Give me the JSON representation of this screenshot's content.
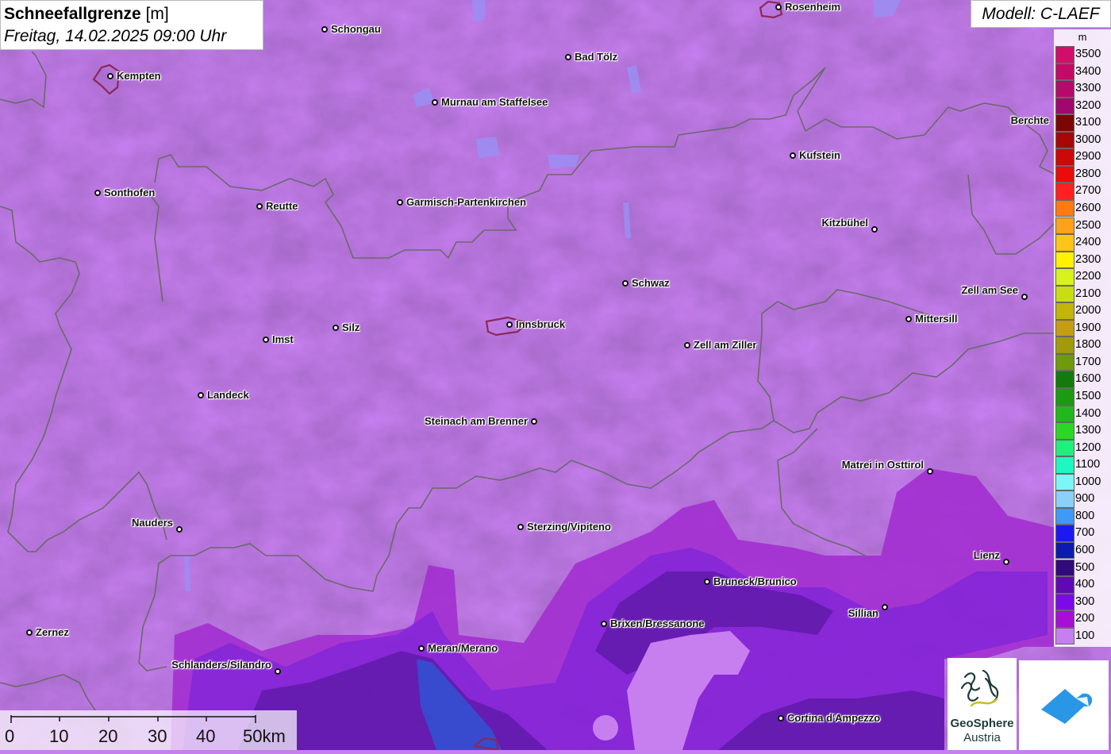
{
  "header": {
    "title_bold": "Schneefallgrenze",
    "title_unit": " [m]",
    "date_line": "Freitag, 14.02.2025 09:00 Uhr",
    "model": "Modell: C-LAEF"
  },
  "legend": {
    "unit": "m",
    "entries": [
      {
        "value": "3500",
        "color": "#d10f6b"
      },
      {
        "value": "3400",
        "color": "#c40a66"
      },
      {
        "value": "3300",
        "color": "#b50a6b"
      },
      {
        "value": "3200",
        "color": "#a0086e"
      },
      {
        "value": "3100",
        "color": "#7a0606"
      },
      {
        "value": "3000",
        "color": "#a80707"
      },
      {
        "value": "2900",
        "color": "#cc0808"
      },
      {
        "value": "2800",
        "color": "#ea0b0b"
      },
      {
        "value": "2700",
        "color": "#ff2020"
      },
      {
        "value": "2600",
        "color": "#ff7a10"
      },
      {
        "value": "2500",
        "color": "#ffa21a"
      },
      {
        "value": "2400",
        "color": "#ffc419"
      },
      {
        "value": "2300",
        "color": "#fff200"
      },
      {
        "value": "2200",
        "color": "#d7f21c"
      },
      {
        "value": "2100",
        "color": "#c8dd12"
      },
      {
        "value": "2000",
        "color": "#c2b40a"
      },
      {
        "value": "1900",
        "color": "#c59d10"
      },
      {
        "value": "1800",
        "color": "#a09a0c"
      },
      {
        "value": "1700",
        "color": "#6e9a0c"
      },
      {
        "value": "1600",
        "color": "#157a0c"
      },
      {
        "value": "1500",
        "color": "#1c9a14"
      },
      {
        "value": "1400",
        "color": "#20b81a"
      },
      {
        "value": "1300",
        "color": "#2ad824"
      },
      {
        "value": "1200",
        "color": "#20ef7e"
      },
      {
        "value": "1100",
        "color": "#1ff7c0"
      },
      {
        "value": "1000",
        "color": "#7cf7f7"
      },
      {
        "value": "900",
        "color": "#8ad0f7"
      },
      {
        "value": "800",
        "color": "#3e9af5"
      },
      {
        "value": "700",
        "color": "#1a1af0"
      },
      {
        "value": "600",
        "color": "#0c1ab0"
      },
      {
        "value": "500",
        "color": "#330a7a"
      },
      {
        "value": "400",
        "color": "#5e0ab0"
      },
      {
        "value": "300",
        "color": "#7c0ae8"
      },
      {
        "value": "200",
        "color": "#a80ed6"
      },
      {
        "value": "100",
        "color": "#c77ff0"
      }
    ]
  },
  "cities": [
    {
      "name": "Rosenheim"
    },
    {
      "name": "Schongau"
    },
    {
      "name": "Kempten"
    },
    {
      "name": "Bad Tölz"
    },
    {
      "name": "Murnau am Staffelsee"
    },
    {
      "name": "Berchte"
    },
    {
      "name": "Kufstein"
    },
    {
      "name": "Sonthofen"
    },
    {
      "name": "Reutte"
    },
    {
      "name": "Garmisch-Partenkirchen"
    },
    {
      "name": "Kitzbühel"
    },
    {
      "name": "Schwaz"
    },
    {
      "name": "Zell am See"
    },
    {
      "name": "Mittersill"
    },
    {
      "name": "Innsbruck"
    },
    {
      "name": "Silz"
    },
    {
      "name": "Imst"
    },
    {
      "name": "Zell am Ziller"
    },
    {
      "name": "Landeck"
    },
    {
      "name": "Steinach am Brenner"
    },
    {
      "name": "Matrei in Osttirol"
    },
    {
      "name": "Nauders"
    },
    {
      "name": "Sterzing/Vipiteno"
    },
    {
      "name": "Lienz"
    },
    {
      "name": "Bruneck/Brunico"
    },
    {
      "name": "Sillian"
    },
    {
      "name": "Brixen/Bressanone"
    },
    {
      "name": "Zernez"
    },
    {
      "name": "Meran/Merano"
    },
    {
      "name": "Schlanders/Silandro"
    },
    {
      "name": "Cortina d'Ampezzo"
    }
  ],
  "scalebar": {
    "ticks": [
      "0",
      "10",
      "20",
      "30",
      "40",
      "50km"
    ]
  },
  "logos": {
    "geosphere_line1": "GeoSphere",
    "geosphere_line2": "Austria"
  },
  "colors": {
    "base_fill": "#c77ff0",
    "border_line": "#6a6a6a"
  }
}
